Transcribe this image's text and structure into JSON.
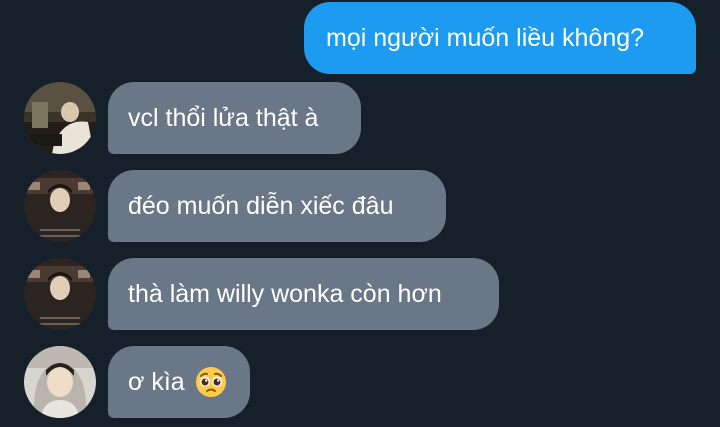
{
  "messages": [
    {
      "sender": "me",
      "text": "mọi người muốn liều không?"
    },
    {
      "sender": "friend-1",
      "text": "vcl thổi lửa thật à"
    },
    {
      "sender": "friend-2",
      "text": "đéo muốn diễn xiếc đâu"
    },
    {
      "sender": "friend-2",
      "text": "thà làm willy wonka còn hơn"
    },
    {
      "sender": "friend-3",
      "text": "ơ kìa",
      "emoji": "pleading-face-emoji"
    }
  ],
  "colors": {
    "background": "#15202b",
    "sent_bubble": "#1d9bf0",
    "received_bubble": "#6a7786",
    "text": "#ffffff"
  }
}
